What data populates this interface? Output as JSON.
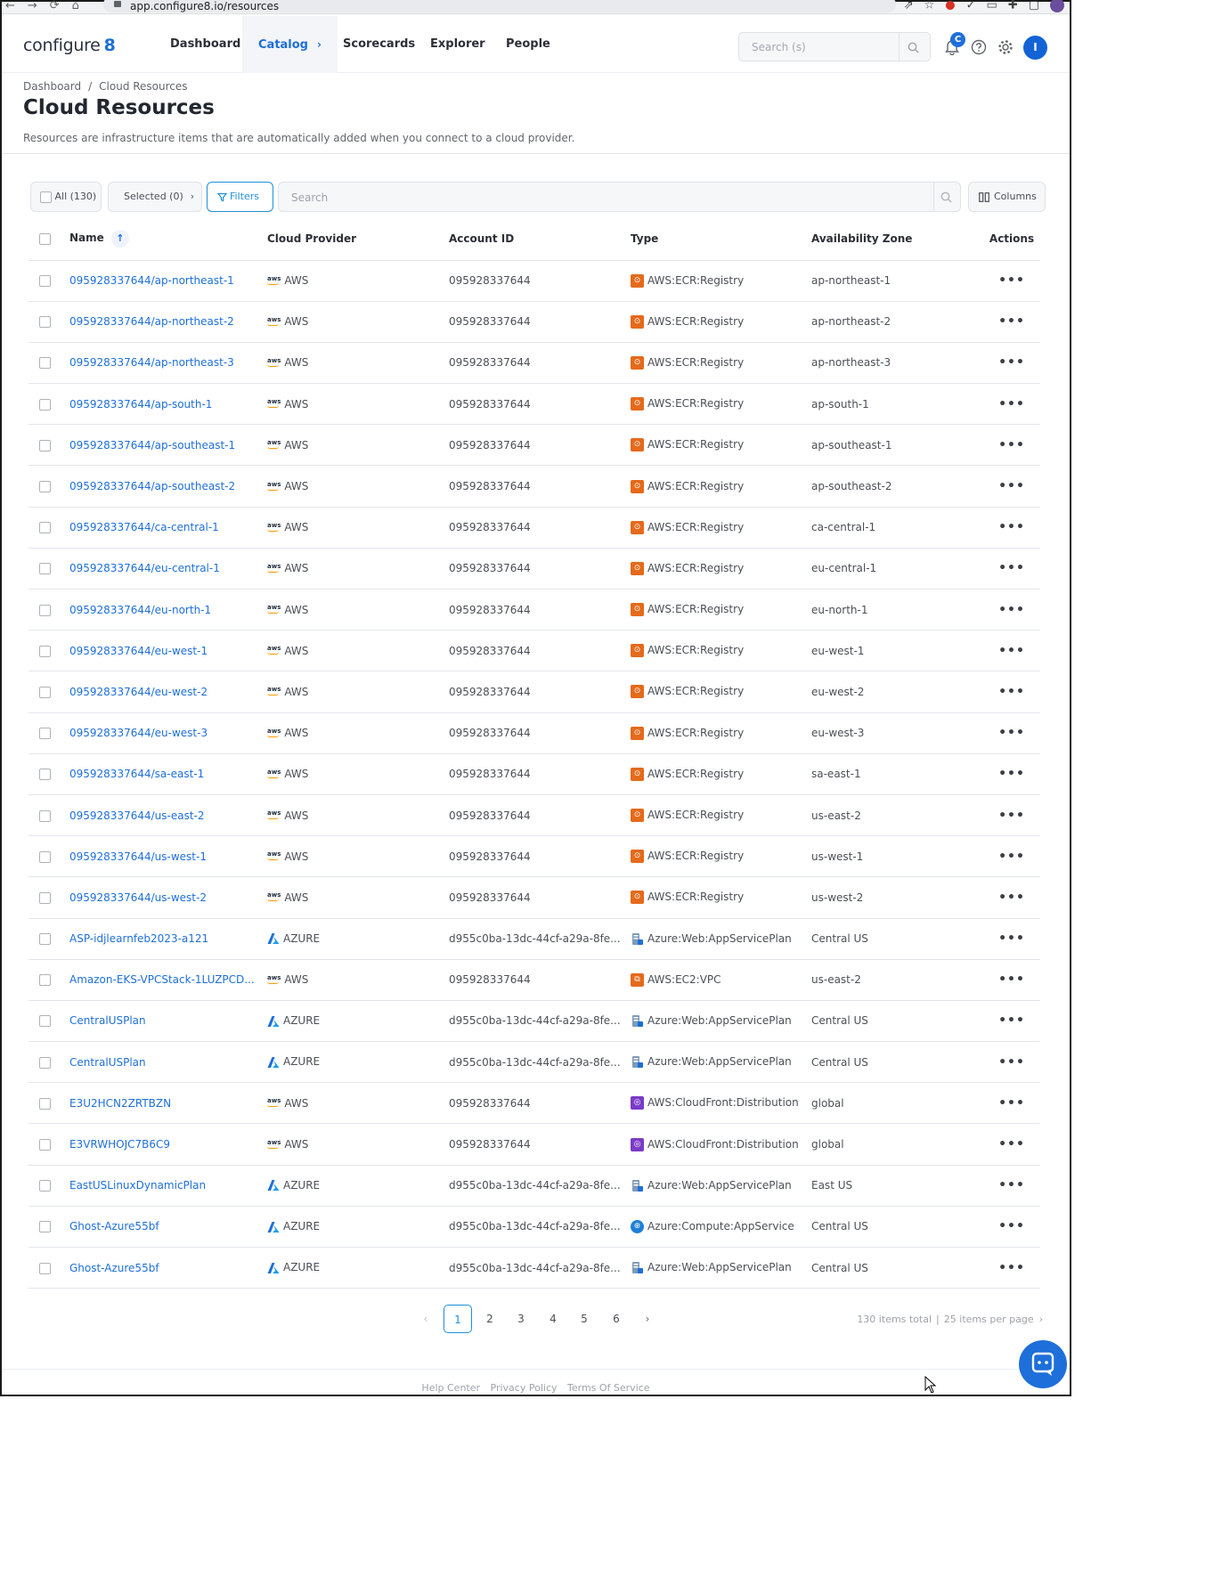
{
  "browser": {
    "url": "app.configure8.io/resources"
  },
  "nav": {
    "logo_text": "configure",
    "logo_mark": "8",
    "items": [
      {
        "label": "Dashboard"
      },
      {
        "label": "Catalog"
      },
      {
        "label": "Scorecards"
      },
      {
        "label": "Explorer"
      },
      {
        "label": "People"
      }
    ],
    "search_placeholder": "Search (s)",
    "notification_count": "C",
    "user_initial": "I"
  },
  "breadcrumb": {
    "root": "Dashboard",
    "separator": "/",
    "current": "Cloud Resources"
  },
  "page": {
    "title": "Cloud Resources",
    "subtitle": "Resources are infrastructure items that are automatically added when you connect to a cloud provider."
  },
  "toolbar": {
    "all_label": "All (130)",
    "selected_label": "Selected (0)",
    "filters_label": "Filters",
    "search_placeholder": "Search",
    "columns_label": "Columns"
  },
  "table": {
    "headers": [
      "Name",
      "Cloud Provider",
      "Account ID",
      "Type",
      "Availability Zone",
      "Actions"
    ],
    "rows": [
      {
        "name": "095928337644/ap-northeast-1",
        "provider": "AWS",
        "account": "095928337644",
        "type": "AWS:ECR:Registry",
        "type_icon": "ecr",
        "zone": "ap-northeast-1"
      },
      {
        "name": "095928337644/ap-northeast-2",
        "provider": "AWS",
        "account": "095928337644",
        "type": "AWS:ECR:Registry",
        "type_icon": "ecr",
        "zone": "ap-northeast-2"
      },
      {
        "name": "095928337644/ap-northeast-3",
        "provider": "AWS",
        "account": "095928337644",
        "type": "AWS:ECR:Registry",
        "type_icon": "ecr",
        "zone": "ap-northeast-3"
      },
      {
        "name": "095928337644/ap-south-1",
        "provider": "AWS",
        "account": "095928337644",
        "type": "AWS:ECR:Registry",
        "type_icon": "ecr",
        "zone": "ap-south-1"
      },
      {
        "name": "095928337644/ap-southeast-1",
        "provider": "AWS",
        "account": "095928337644",
        "type": "AWS:ECR:Registry",
        "type_icon": "ecr",
        "zone": "ap-southeast-1"
      },
      {
        "name": "095928337644/ap-southeast-2",
        "provider": "AWS",
        "account": "095928337644",
        "type": "AWS:ECR:Registry",
        "type_icon": "ecr",
        "zone": "ap-southeast-2"
      },
      {
        "name": "095928337644/ca-central-1",
        "provider": "AWS",
        "account": "095928337644",
        "type": "AWS:ECR:Registry",
        "type_icon": "ecr",
        "zone": "ca-central-1"
      },
      {
        "name": "095928337644/eu-central-1",
        "provider": "AWS",
        "account": "095928337644",
        "type": "AWS:ECR:Registry",
        "type_icon": "ecr",
        "zone": "eu-central-1"
      },
      {
        "name": "095928337644/eu-north-1",
        "provider": "AWS",
        "account": "095928337644",
        "type": "AWS:ECR:Registry",
        "type_icon": "ecr",
        "zone": "eu-north-1"
      },
      {
        "name": "095928337644/eu-west-1",
        "provider": "AWS",
        "account": "095928337644",
        "type": "AWS:ECR:Registry",
        "type_icon": "ecr",
        "zone": "eu-west-1"
      },
      {
        "name": "095928337644/eu-west-2",
        "provider": "AWS",
        "account": "095928337644",
        "type": "AWS:ECR:Registry",
        "type_icon": "ecr",
        "zone": "eu-west-2"
      },
      {
        "name": "095928337644/eu-west-3",
        "provider": "AWS",
        "account": "095928337644",
        "type": "AWS:ECR:Registry",
        "type_icon": "ecr",
        "zone": "eu-west-3"
      },
      {
        "name": "095928337644/sa-east-1",
        "provider": "AWS",
        "account": "095928337644",
        "type": "AWS:ECR:Registry",
        "type_icon": "ecr",
        "zone": "sa-east-1"
      },
      {
        "name": "095928337644/us-east-2",
        "provider": "AWS",
        "account": "095928337644",
        "type": "AWS:ECR:Registry",
        "type_icon": "ecr",
        "zone": "us-east-2"
      },
      {
        "name": "095928337644/us-west-1",
        "provider": "AWS",
        "account": "095928337644",
        "type": "AWS:ECR:Registry",
        "type_icon": "ecr",
        "zone": "us-west-1"
      },
      {
        "name": "095928337644/us-west-2",
        "provider": "AWS",
        "account": "095928337644",
        "type": "AWS:ECR:Registry",
        "type_icon": "ecr",
        "zone": "us-west-2"
      },
      {
        "name": "ASP-idjlearnfeb2023-a121",
        "provider": "AZURE",
        "account": "d955c0ba-13dc-44cf-a29a-8fe...",
        "type": "Azure:Web:AppServicePlan",
        "type_icon": "asp",
        "zone": "Central US"
      },
      {
        "name": "Amazon-EKS-VPCStack-1LUZPCD...",
        "provider": "AWS",
        "account": "095928337644",
        "type": "AWS:EC2:VPC",
        "type_icon": "vpc",
        "zone": "us-east-2"
      },
      {
        "name": "CentralUSPlan",
        "provider": "AZURE",
        "account": "d955c0ba-13dc-44cf-a29a-8fe...",
        "type": "Azure:Web:AppServicePlan",
        "type_icon": "asp",
        "zone": "Central US"
      },
      {
        "name": "CentralUSPlan",
        "provider": "AZURE",
        "account": "d955c0ba-13dc-44cf-a29a-8fe...",
        "type": "Azure:Web:AppServicePlan",
        "type_icon": "asp",
        "zone": "Central US"
      },
      {
        "name": "E3U2HCN2ZRTBZN",
        "provider": "AWS",
        "account": "095928337644",
        "type": "AWS:CloudFront:Distribution",
        "type_icon": "cf",
        "zone": "global"
      },
      {
        "name": "E3VRWHOJC7B6C9",
        "provider": "AWS",
        "account": "095928337644",
        "type": "AWS:CloudFront:Distribution",
        "type_icon": "cf",
        "zone": "global"
      },
      {
        "name": "EastUSLinuxDynamicPlan",
        "provider": "AZURE",
        "account": "d955c0ba-13dc-44cf-a29a-8fe...",
        "type": "Azure:Web:AppServicePlan",
        "type_icon": "asp",
        "zone": "East US"
      },
      {
        "name": "Ghost-Azure55bf",
        "provider": "AZURE",
        "account": "d955c0ba-13dc-44cf-a29a-8fe...",
        "type": "Azure:Compute:AppService",
        "type_icon": "app",
        "zone": "Central US"
      },
      {
        "name": "Ghost-Azure55bf",
        "provider": "AZURE",
        "account": "d955c0ba-13dc-44cf-a29a-8fe...",
        "type": "Azure:Web:AppServicePlan",
        "type_icon": "asp",
        "zone": "Central US"
      }
    ],
    "actions_label": "•••"
  },
  "pagination": {
    "pages": [
      "1",
      "2",
      "3",
      "4",
      "5",
      "6"
    ],
    "current": "1",
    "total_label": "130 items total",
    "per_page_label": "25 items per page"
  },
  "footer": {
    "links": [
      "Help Center",
      "Privacy Policy",
      "Terms Of Service"
    ]
  },
  "colors": {
    "accent": "#1e6fd9",
    "aws_orange": "#ff9900",
    "ecr": "#e56a1b",
    "cloudfront": "#7b3ac8"
  }
}
